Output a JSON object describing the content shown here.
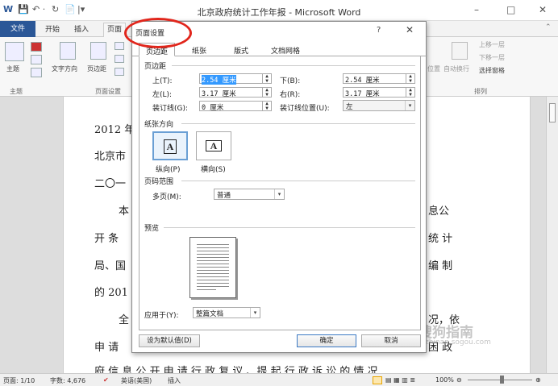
{
  "window": {
    "title": "北京政府统计工作年报 - Microsoft Word",
    "min": "–",
    "max": "□",
    "close": "✕",
    "quick_access": [
      "W",
      "💾",
      "↶ ·",
      "↻",
      "📄",
      "|▾"
    ]
  },
  "ribbon_tabs": [
    "文件",
    "开始",
    "插入",
    "页面"
  ],
  "ribbon": {
    "theme_label": "主题",
    "text_dir_label": "文字方向",
    "margins_label": "页边距",
    "page_setup_group": "页面设置",
    "theme_group": "主题",
    "arrange_group": "排列",
    "bring_forward": "上移一层",
    "send_backward": "下移一层",
    "selection_pane": "选择窗格",
    "auto_wrap": "自动换行",
    "position": "位置"
  },
  "document": {
    "lines": [
      "2012 年",
      "北京市",
      "二〇一",
      "本",
      "息公",
      "开 条",
      "统 计",
      "局、国",
      "编 制",
      "的 201",
      "全",
      "况，依",
      "申 请",
      "困 政",
      "府 信 息 公 开 申 请 行 政 复 议 、提 起 行 政 诉 讼 的 情 况"
    ]
  },
  "status": {
    "page": "页面: 1/10",
    "words": "字数: 4,676",
    "language": "英语(美国)",
    "mode": "插入",
    "zoom": "100%"
  },
  "watermark": {
    "text": "搜狗指南",
    "sub": "zhinan.sogou.com"
  },
  "dialog": {
    "title": "页面设置",
    "help": "?",
    "close": "✕",
    "tabs": [
      "页边距",
      "纸张",
      "版式",
      "文档网格"
    ],
    "margins_section": "页边距",
    "top_label": "上(T):",
    "top_value": "2.54 厘米",
    "bottom_label": "下(B):",
    "bottom_value": "2.54 厘米",
    "left_label": "左(L):",
    "left_value": "3.17 厘米",
    "right_label": "右(R):",
    "right_value": "3.17 厘米",
    "gutter_label": "装订线(G):",
    "gutter_value": "0 厘米",
    "gutter_pos_label": "装订线位置(U):",
    "gutter_pos_value": "左",
    "orientation_section": "纸张方向",
    "portrait_label": "纵向(P)",
    "landscape_label": "横向(S)",
    "orientation_glyph": "A",
    "pages_section": "页码范围",
    "multi_pages_label": "多页(M):",
    "multi_pages_value": "普通",
    "preview_section": "预览",
    "apply_to_label": "应用于(Y):",
    "apply_to_value": "整篇文档",
    "default_button": "设为默认值(D)",
    "ok_button": "确定",
    "cancel_button": "取消"
  },
  "colors": {
    "file_tab": "#2b5797",
    "annotation": "#e1261c"
  }
}
